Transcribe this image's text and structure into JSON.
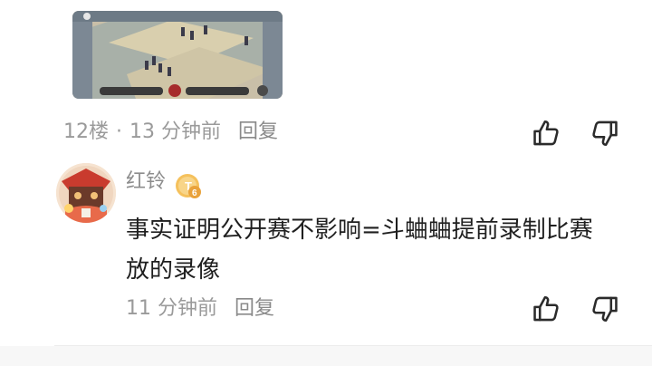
{
  "prev_comment": {
    "floor": "12楼",
    "separator": "·",
    "time": "13 分钟前",
    "reply_label": "回复",
    "image_alt_icon": "game-screenshot"
  },
  "comment": {
    "username": "红铃",
    "badge_label": "6",
    "text": "事实证明公开赛不影响=斗蛐蛐提前录制比赛放的录像",
    "time": "11 分钟前",
    "reply_label": "回复"
  },
  "icons": {
    "like": "thumbs-up-icon",
    "dislike": "thumbs-down-icon"
  },
  "colors": {
    "meta_text": "#9a9a9a",
    "body_text": "#1f1f1f",
    "badge": "#f0b64a"
  }
}
